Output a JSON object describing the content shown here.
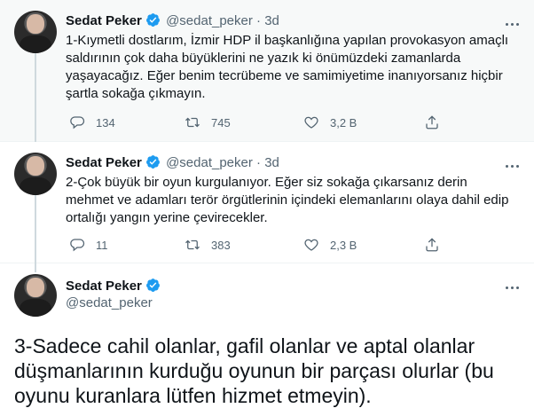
{
  "tweets": [
    {
      "name": "Sedat Peker",
      "handle": "@sedat_peker",
      "dot": "·",
      "time": "3d",
      "text": "1-Kıymetli dostlarım, İzmir HDP il başkanlığına yapılan provokasyon amaçlı saldırının çok daha büyüklerini ne yazık ki önümüzdeki zamanlarda yaşayacağız. Eğer benim tecrübeme ve samimiyetime inanıyorsanız hiçbir şartla sokağa çıkmayın.",
      "replies": "134",
      "retweets": "745",
      "likes": "3,2 B"
    },
    {
      "name": "Sedat Peker",
      "handle": "@sedat_peker",
      "dot": "·",
      "time": "3d",
      "text": "2-Çok büyük bir oyun kurgulanıyor. Eğer siz sokağa çıkarsanız derin mehmet ve adamları terör örgütlerinin içindeki elemanlarını olaya dahil edip ortalığı yangın yerine çevirecekler.",
      "replies": "11",
      "retweets": "383",
      "likes": "2,3 B"
    },
    {
      "name": "Sedat Peker",
      "handle": "@sedat_peker",
      "text": "3-Sadece cahil olanlar, gafil olanlar ve aptal olanlar düşmanlarının kurduğu oyunun bir parçası olurlar (bu oyunu kuranlara lütfen hizmet etmeyin)."
    }
  ],
  "colors": {
    "verified": "#1d9bf0",
    "muted": "#536471",
    "text": "#0f1419",
    "thread_line": "#cfd9de"
  }
}
